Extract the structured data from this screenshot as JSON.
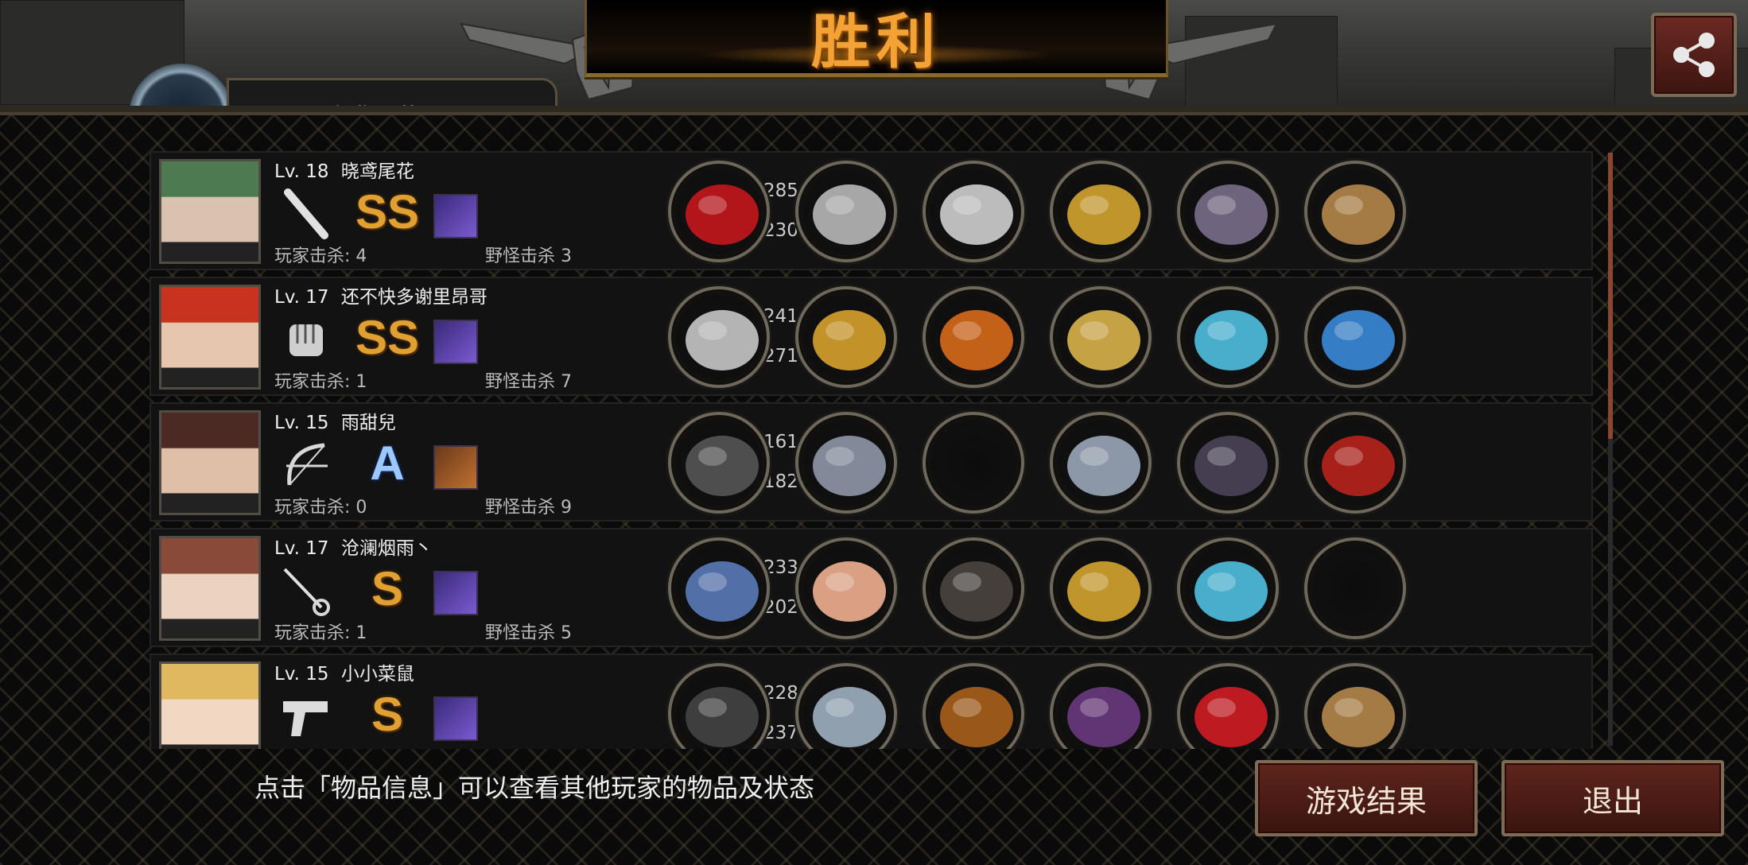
{
  "header": {
    "title": "胜利",
    "player_tab_name": "晓鸢尾花"
  },
  "colors": {
    "title": "#f3a235",
    "grade_gold": "#e0a032",
    "grade_blue": "#9cc7ff",
    "button_bg": "#5e251c"
  },
  "labels": {
    "lv_prefix": "Lv.",
    "player_kills": "玩家击杀:",
    "monster_kills": "野怪击杀"
  },
  "players": [
    {
      "level": "18",
      "name": "晓鸢尾花",
      "weapon_icon": "bat-icon",
      "grade": "SS",
      "skill_icon": "purple-skill-icon",
      "player_kills": "4",
      "monster_kills": "3",
      "attack": "285",
      "defense": "230",
      "items": [
        "red-scarf-icon",
        "knight-helmet-icon",
        "plate-armor-icon",
        "gold-bracelet-icon",
        "boots-icon",
        "supply-box-icon"
      ]
    },
    {
      "level": "17",
      "name": "还不快多谢里昂哥",
      "weapon_icon": "fist-icon",
      "grade": "SS",
      "skill_icon": "purple-skill-icon",
      "player_kills": "1",
      "monster_kills": "7",
      "attack": "241",
      "defense": "271",
      "items": [
        "gauntlet-icon",
        "crown-icon",
        "flame-armor-icon",
        "shield-amulet-icon",
        "sneaker-icon",
        "blue-gem-ring-icon"
      ]
    },
    {
      "level": "15",
      "name": "雨甜兒",
      "weapon_icon": "bow-icon",
      "grade": "A",
      "skill_icon": "crossed-skill-icon",
      "player_kills": "0",
      "monster_kills": "9",
      "attack": "161",
      "defense": "182",
      "items": [
        "crossbow-icon",
        "visor-helmet-icon",
        "empty-slot",
        "watch-icon",
        "dark-glove-icon",
        "quiver-icon"
      ]
    },
    {
      "level": "17",
      "name": "沧澜烟雨丶",
      "weapon_icon": "rapier-icon",
      "grade": "S",
      "skill_icon": "purple-skill-icon",
      "player_kills": "1",
      "monster_kills": "5",
      "attack": "233",
      "defense": "202",
      "items": [
        "spear-icon",
        "winged-tiara-icon",
        "leather-jacket-icon",
        "gold-bracelet-icon",
        "sneaker-icon",
        "empty-slot"
      ]
    },
    {
      "level": "15",
      "name": "小小菜鼠",
      "weapon_icon": "pistol-icon",
      "grade": "S",
      "skill_icon": "purple-skill-icon",
      "player_kills": "",
      "monster_kills": "",
      "attack": "228",
      "defense": "237",
      "items": [
        "minigun-icon",
        "silver-helmet-icon",
        "bronze-armor-icon",
        "purple-gauntlet-icon",
        "red-heels-icon",
        "supply-box-icon"
      ]
    }
  ],
  "footer": {
    "hint": "点击「物品信息」可以查看其他玩家的物品及状态",
    "result_button": "游戏结果",
    "exit_button": "退出"
  }
}
